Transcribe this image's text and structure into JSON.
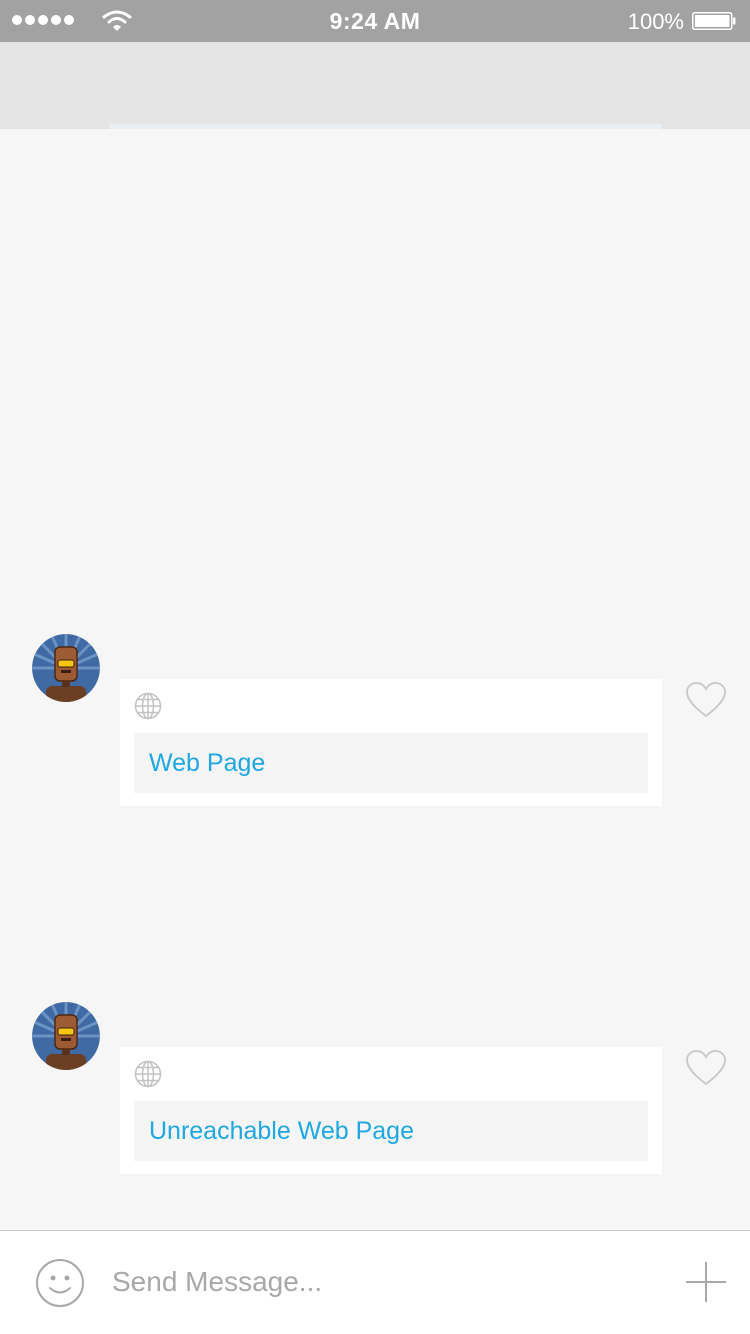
{
  "status_bar": {
    "signal_dots": 5,
    "time": "9:24 AM",
    "battery_percent": "100%",
    "battery_level": 1.0
  },
  "messages": [
    {
      "avatar_icon": "robot-avatar-icon",
      "link_icon": "globe-icon",
      "link_text": "Web Page",
      "like_icon": "heart-outline-icon"
    },
    {
      "avatar_icon": "robot-avatar-icon",
      "link_icon": "globe-icon",
      "link_text": "Unreachable Web Page",
      "like_icon": "heart-outline-icon"
    }
  ],
  "input_bar": {
    "emoji_icon": "smiley-icon",
    "placeholder": "Send Message...",
    "value": "",
    "add_icon": "plus-icon"
  },
  "colors": {
    "status_bar_bg": "#a2a2a2",
    "nav_bar_bg": "#e4e4e4",
    "chat_bg": "#f6f6f6",
    "link_text": "#1ea7e1",
    "icon_gray": "#c8c8c8"
  }
}
